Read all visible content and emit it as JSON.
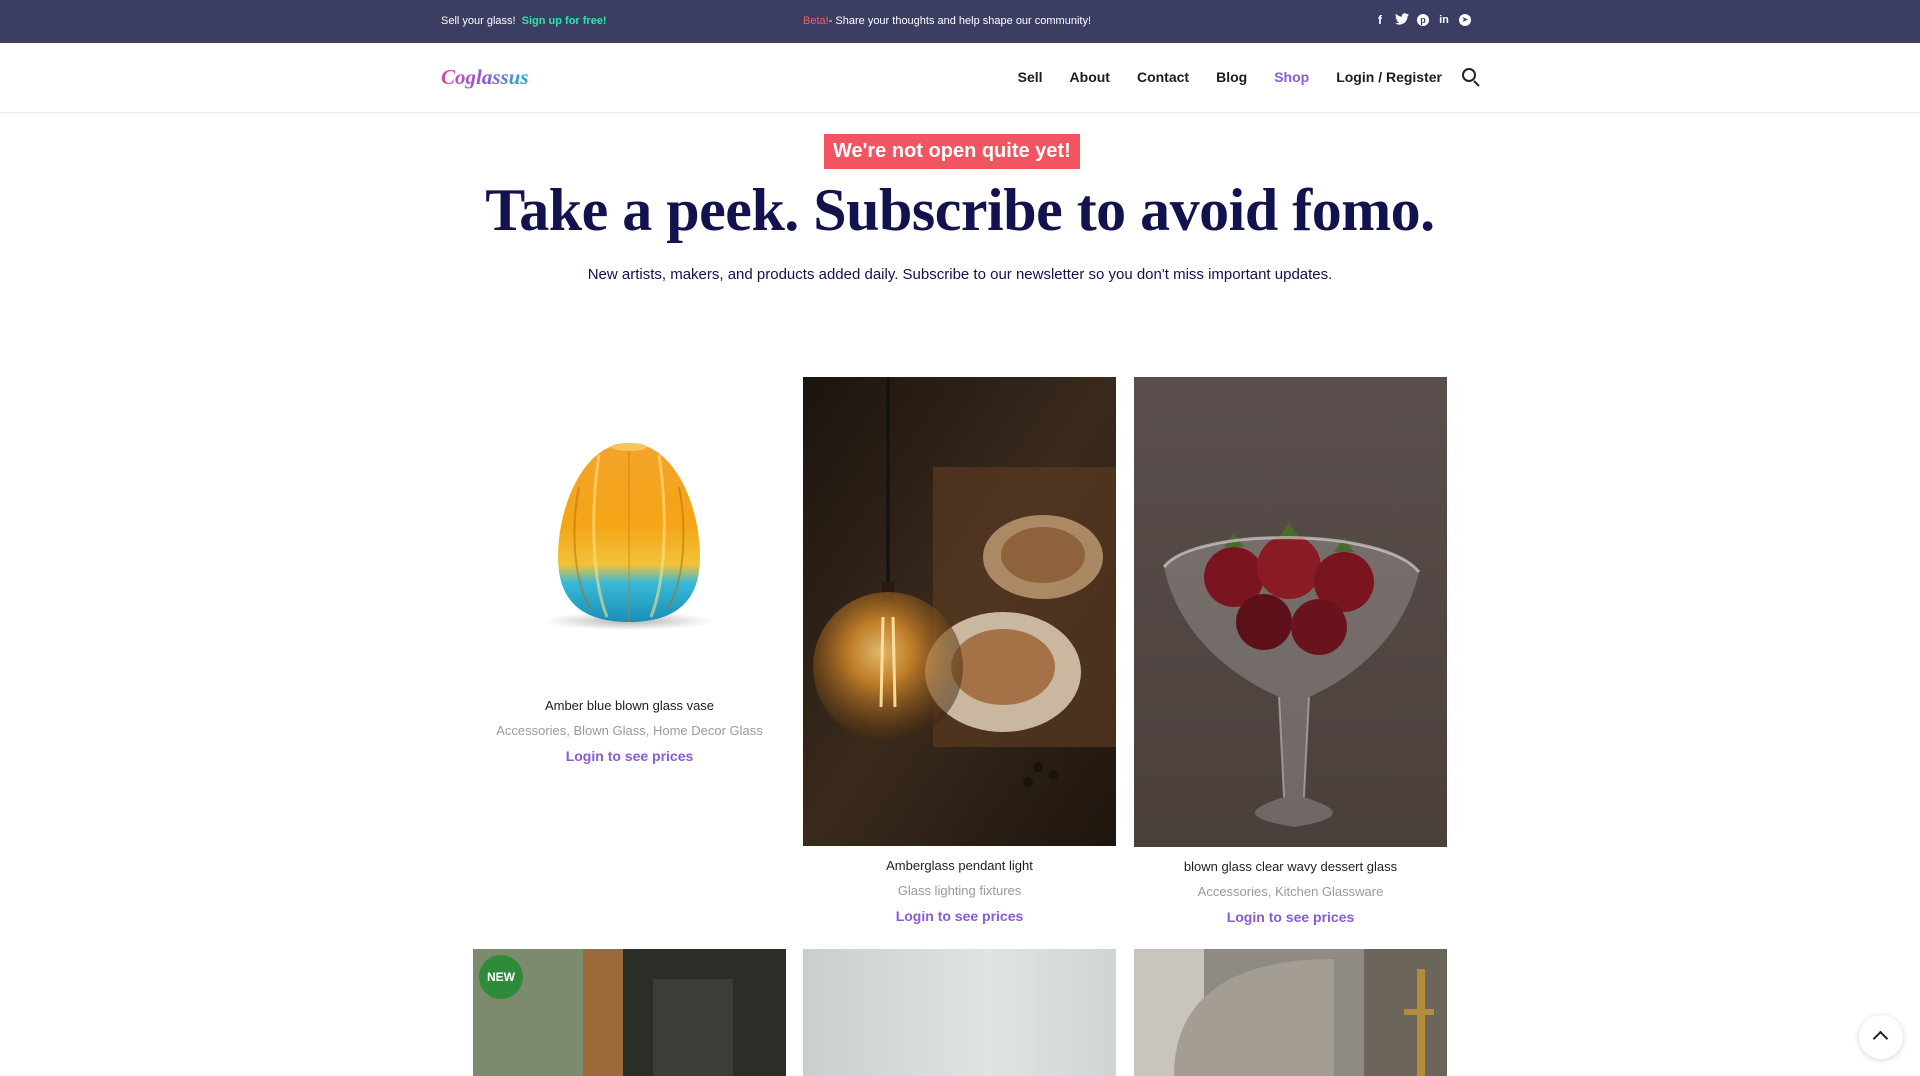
{
  "topbar": {
    "left_text": "Sell your glass!",
    "left_link": "Sign up for free!",
    "beta_label": "Beta!",
    "center_text": "- Share your thoughts and help shape our community!",
    "social": [
      "facebook-icon",
      "twitter-icon",
      "pinterest-icon",
      "linkedin-icon",
      "telegram-icon"
    ]
  },
  "header": {
    "logo": "Coglassus",
    "nav": [
      "Sell",
      "About",
      "Contact",
      "Blog",
      "Shop",
      "Login / Register"
    ],
    "active": "Shop"
  },
  "hero": {
    "badge": "We're not open quite yet!",
    "headline": "Take a peek. Subscribe to avoid fomo.",
    "subline": "New artists, makers, and products added daily. Subscribe to our newsletter so you don't miss important updates."
  },
  "products": [
    {
      "title": "Amber blue blown glass vase",
      "categories": "Accessories, Blown Glass, Home Decor Glass",
      "price_label": "Login to see prices"
    },
    {
      "title": "Amberglass pendant light",
      "categories": "Glass lighting fixtures",
      "price_label": "Login to see prices"
    },
    {
      "title": "blown glass clear wavy dessert glass",
      "categories": "Accessories, Kitchen Glassware",
      "price_label": "Login to see prices"
    }
  ],
  "second_row": {
    "new_badge": "NEW"
  },
  "colors": {
    "topbar": "#3b3d63",
    "accent": "#8a5bd6",
    "badge": "#f25461",
    "headline": "#12124f",
    "signup": "#2ee6a5",
    "new": "#2e8b3a"
  }
}
